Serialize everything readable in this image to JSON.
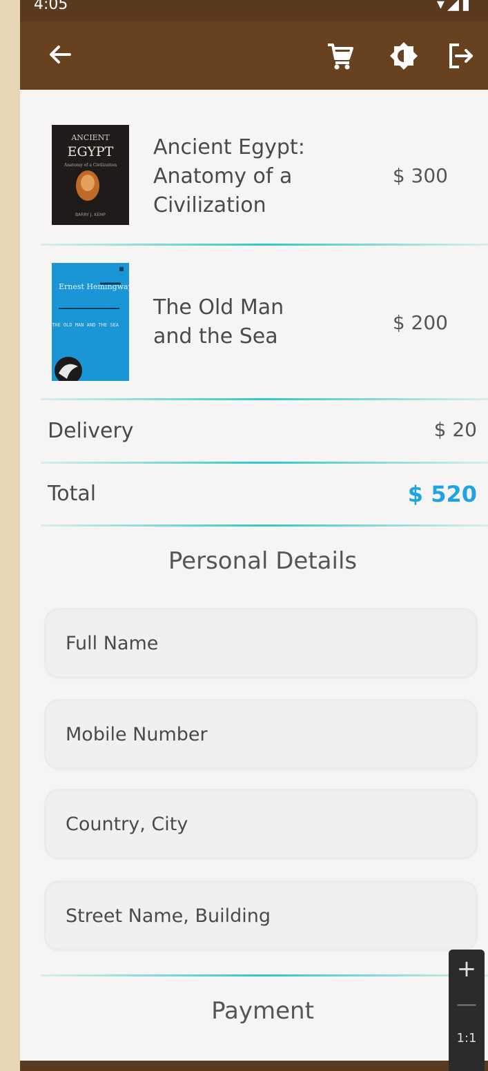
{
  "status_bar": {
    "time": "4:05",
    "icons": "▾◢▮"
  },
  "app_bar": {
    "back_icon": "arrow-left",
    "actions": [
      "cart-icon",
      "brightness-icon",
      "logout-icon"
    ]
  },
  "cart": {
    "items": [
      {
        "title": "Ancient Egypt: Anatomy of a Civilization",
        "title_lines": [
          "Ancient Egypt:",
          "Anatomy of a",
          "Civilization"
        ],
        "price": "$ 300",
        "cover": {
          "top": "ANCIENT",
          "main": "EGYPT",
          "sub": "Anatomy of a Civilization",
          "author": "BARRY J. KEMP"
        }
      },
      {
        "title": "The Old Man and the Sea",
        "title_lines": [
          "The Old Man",
          "and the Sea"
        ],
        "price": "$ 200",
        "cover": {
          "author": "Ernest Hemingway",
          "title": "THE OLD MAN AND THE SEA"
        }
      }
    ],
    "delivery_label": "Delivery",
    "delivery_value": "$ 20",
    "total_label": "Total",
    "total_value": "$ 520"
  },
  "personal_details": {
    "title": "Personal Details",
    "fields": [
      {
        "placeholder": "Full Name"
      },
      {
        "placeholder": "Mobile Number"
      },
      {
        "placeholder": "Country, City"
      },
      {
        "placeholder": "Street Name, Building"
      }
    ]
  },
  "payment": {
    "title": "Payment"
  },
  "zoom_control": {
    "plus": "+",
    "minus": "—",
    "ratio": "1:1"
  },
  "colors": {
    "app_bar": "#68411f",
    "accent_total": "#1ea4e6",
    "divider": "#2fc8c5",
    "page_bg": "#e8d7b6"
  }
}
